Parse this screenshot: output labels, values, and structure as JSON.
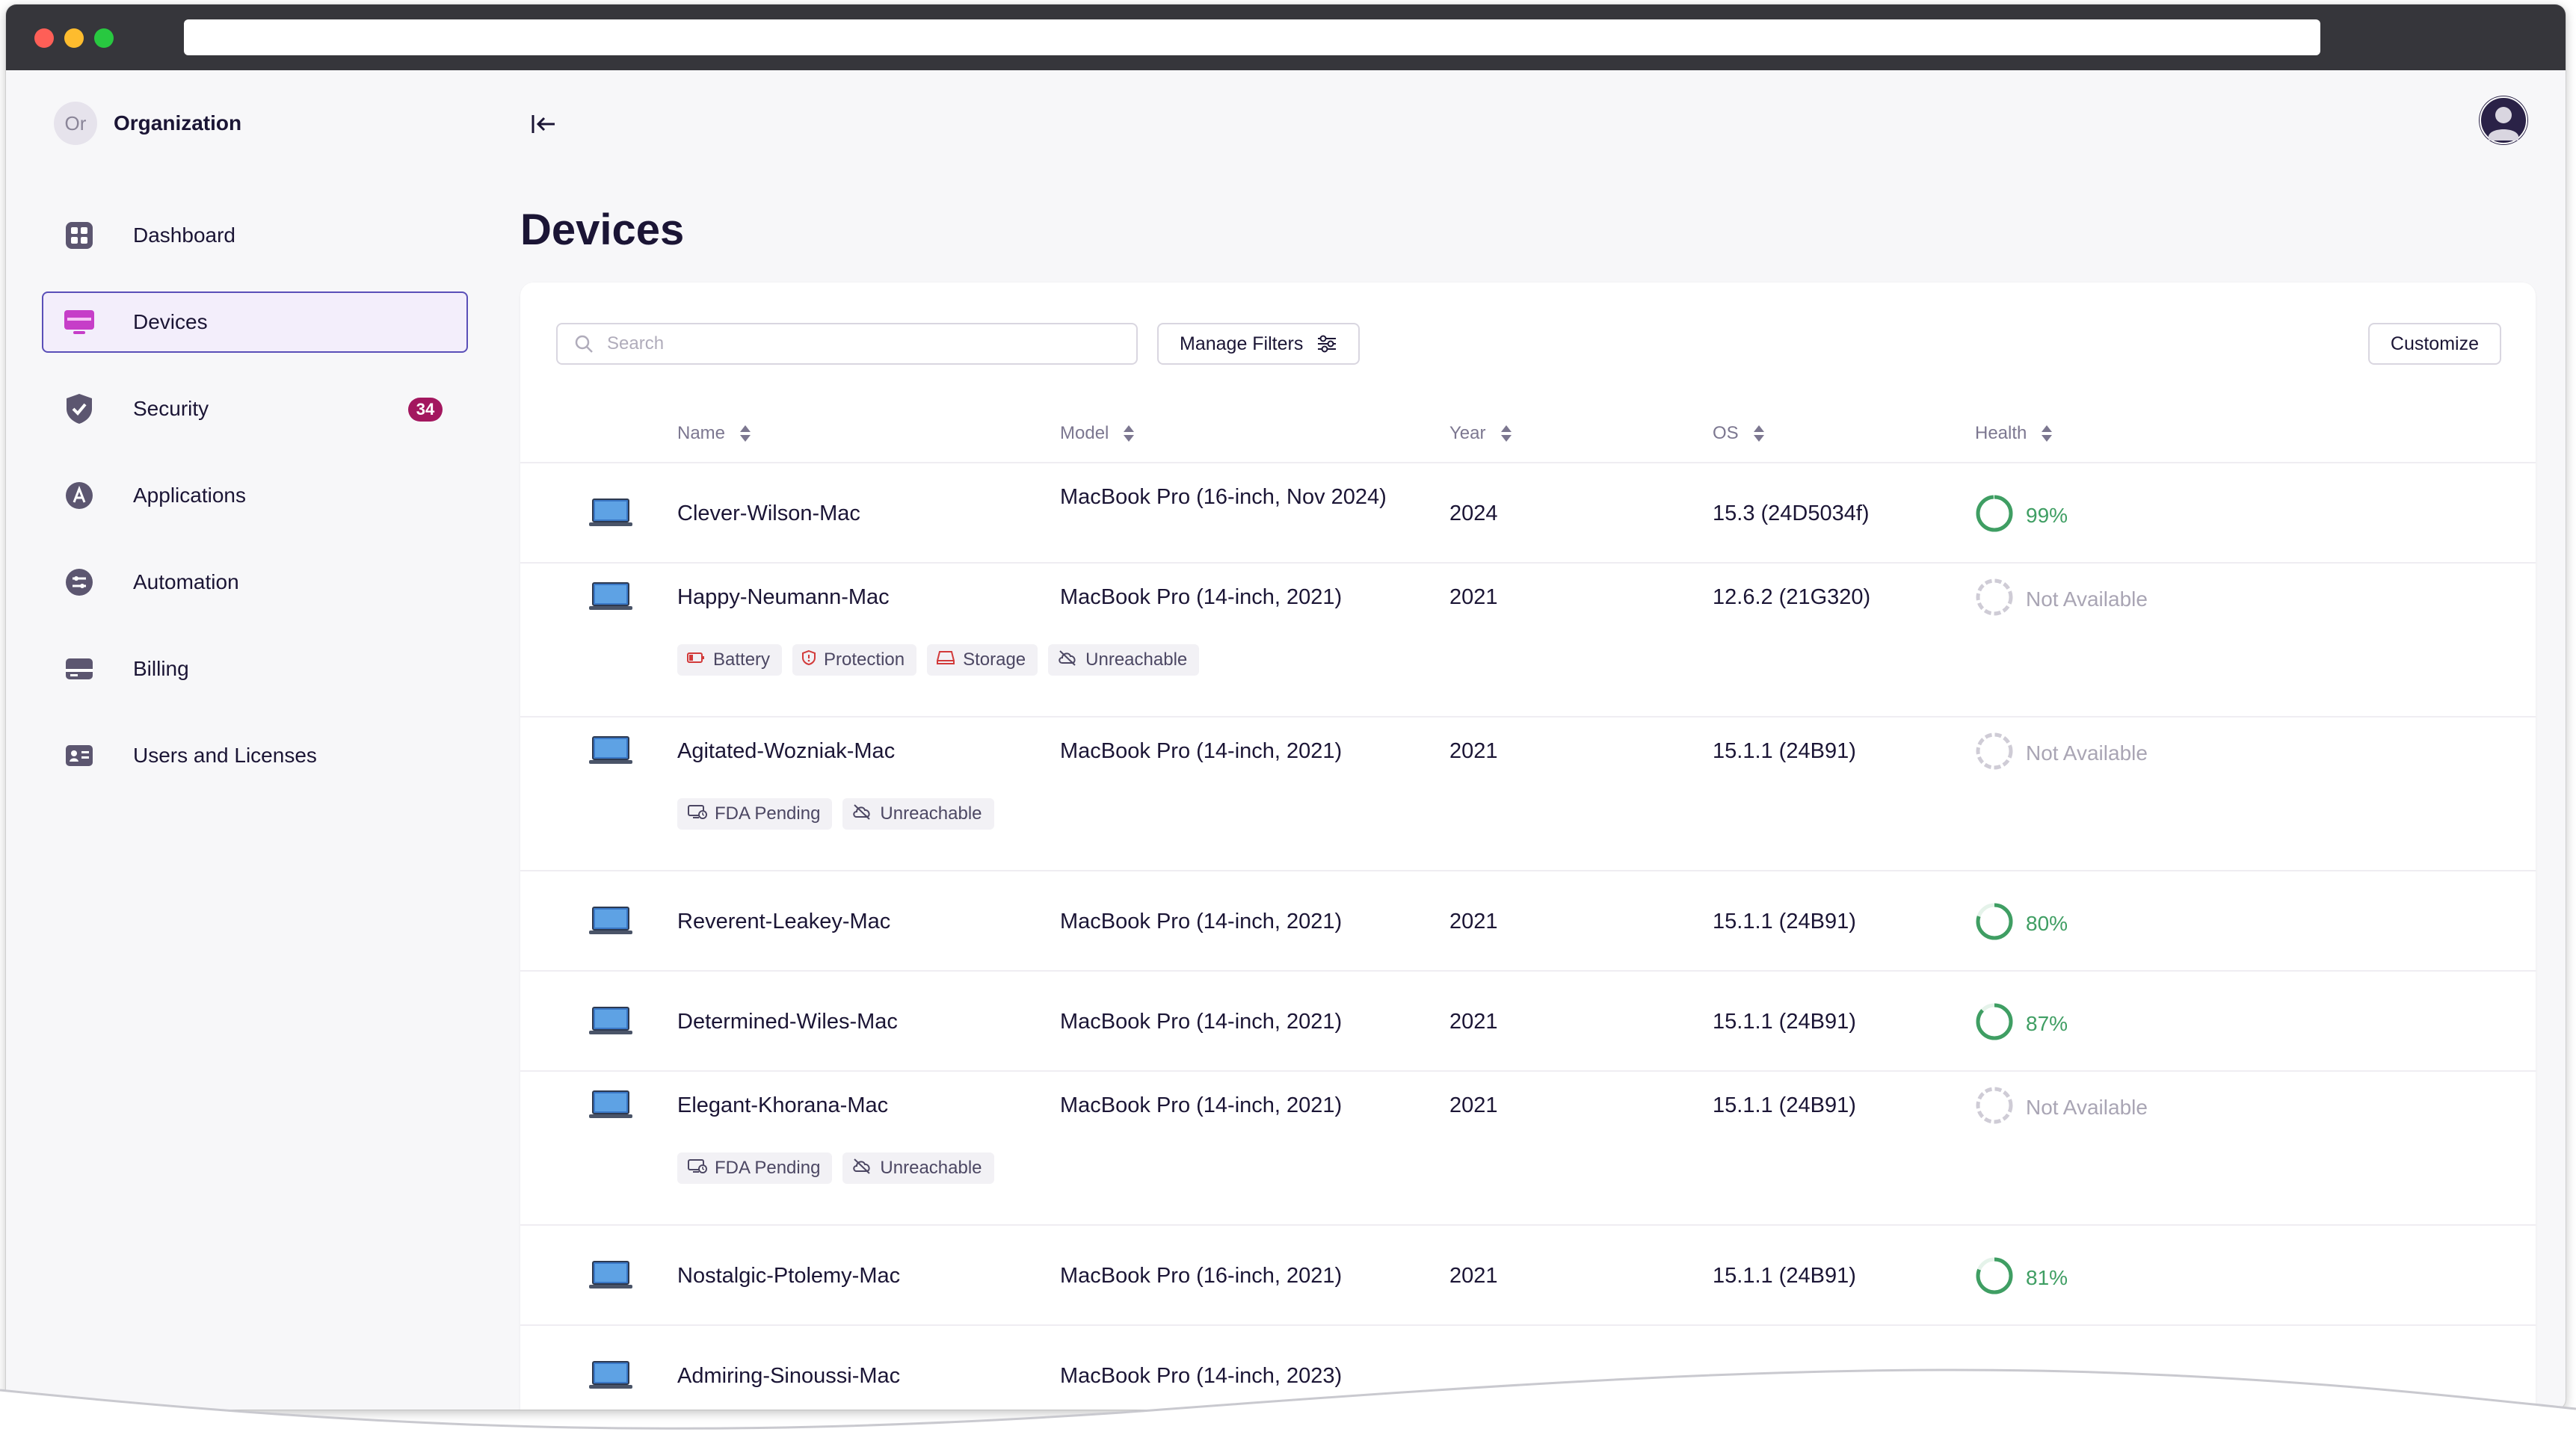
{
  "sidebar": {
    "org": {
      "initials": "Or",
      "name": "Organization"
    },
    "items": [
      {
        "label": "Dashboard",
        "icon": "dashboard-icon",
        "active": false
      },
      {
        "label": "Devices",
        "icon": "devices-icon",
        "active": true
      },
      {
        "label": "Security",
        "icon": "shield-icon",
        "active": false,
        "badge": "34"
      },
      {
        "label": "Applications",
        "icon": "applications-icon",
        "active": false
      },
      {
        "label": "Automation",
        "icon": "automation-icon",
        "active": false
      },
      {
        "label": "Billing",
        "icon": "billing-icon",
        "active": false
      },
      {
        "label": "Users and Licenses",
        "icon": "users-icon",
        "active": false
      }
    ]
  },
  "header": {
    "title": "Devices"
  },
  "toolbar": {
    "search_placeholder": "Search",
    "filters_label": "Manage Filters",
    "customize_label": "Customize"
  },
  "table": {
    "columns": [
      "Name",
      "Model",
      "Year",
      "OS",
      "Health"
    ],
    "rows": [
      {
        "name": "Clever-Wilson-Mac",
        "model": "MacBook Pro (16-inch, Nov 2024)",
        "year": "2024",
        "os": "15.3 (24D5034f)",
        "health": "99%",
        "health_value": 0.99,
        "tags": []
      },
      {
        "name": "Happy-Neumann-Mac",
        "model": "MacBook Pro (14-inch, 2021)",
        "year": "2021",
        "os": "12.6.2 (21G320)",
        "health": "Not Available",
        "health_value": null,
        "tags": [
          "Battery",
          "Protection",
          "Storage",
          "Unreachable"
        ]
      },
      {
        "name": "Agitated-Wozniak-Mac",
        "model": "MacBook Pro (14-inch, 2021)",
        "year": "2021",
        "os": "15.1.1 (24B91)",
        "health": "Not Available",
        "health_value": null,
        "tags": [
          "FDA Pending",
          "Unreachable"
        ]
      },
      {
        "name": "Reverent-Leakey-Mac",
        "model": "MacBook Pro (14-inch, 2021)",
        "year": "2021",
        "os": "15.1.1 (24B91)",
        "health": "80%",
        "health_value": 0.8,
        "tags": []
      },
      {
        "name": "Determined-Wiles-Mac",
        "model": "MacBook Pro (14-inch, 2021)",
        "year": "2021",
        "os": "15.1.1 (24B91)",
        "health": "87%",
        "health_value": 0.87,
        "tags": []
      },
      {
        "name": "Elegant-Khorana-Mac",
        "model": "MacBook Pro (14-inch, 2021)",
        "year": "2021",
        "os": "15.1.1 (24B91)",
        "health": "Not Available",
        "health_value": null,
        "tags": [
          "FDA Pending",
          "Unreachable"
        ]
      },
      {
        "name": "Nostalgic-Ptolemy-Mac",
        "model": "MacBook Pro (16-inch, 2021)",
        "year": "2021",
        "os": "15.1.1 (24B91)",
        "health": "81%",
        "health_value": 0.81,
        "tags": []
      },
      {
        "name": "Admiring-Sinoussi-Mac",
        "model": "MacBook Pro (14-inch, 2023)",
        "year": "",
        "os": "",
        "health": "",
        "health_value": null,
        "tags": []
      }
    ]
  },
  "colors": {
    "accent": "#5a4fb8",
    "badge": "#a3175f",
    "health_good": "#3f9e63",
    "health_na": "#a9a5b4"
  }
}
